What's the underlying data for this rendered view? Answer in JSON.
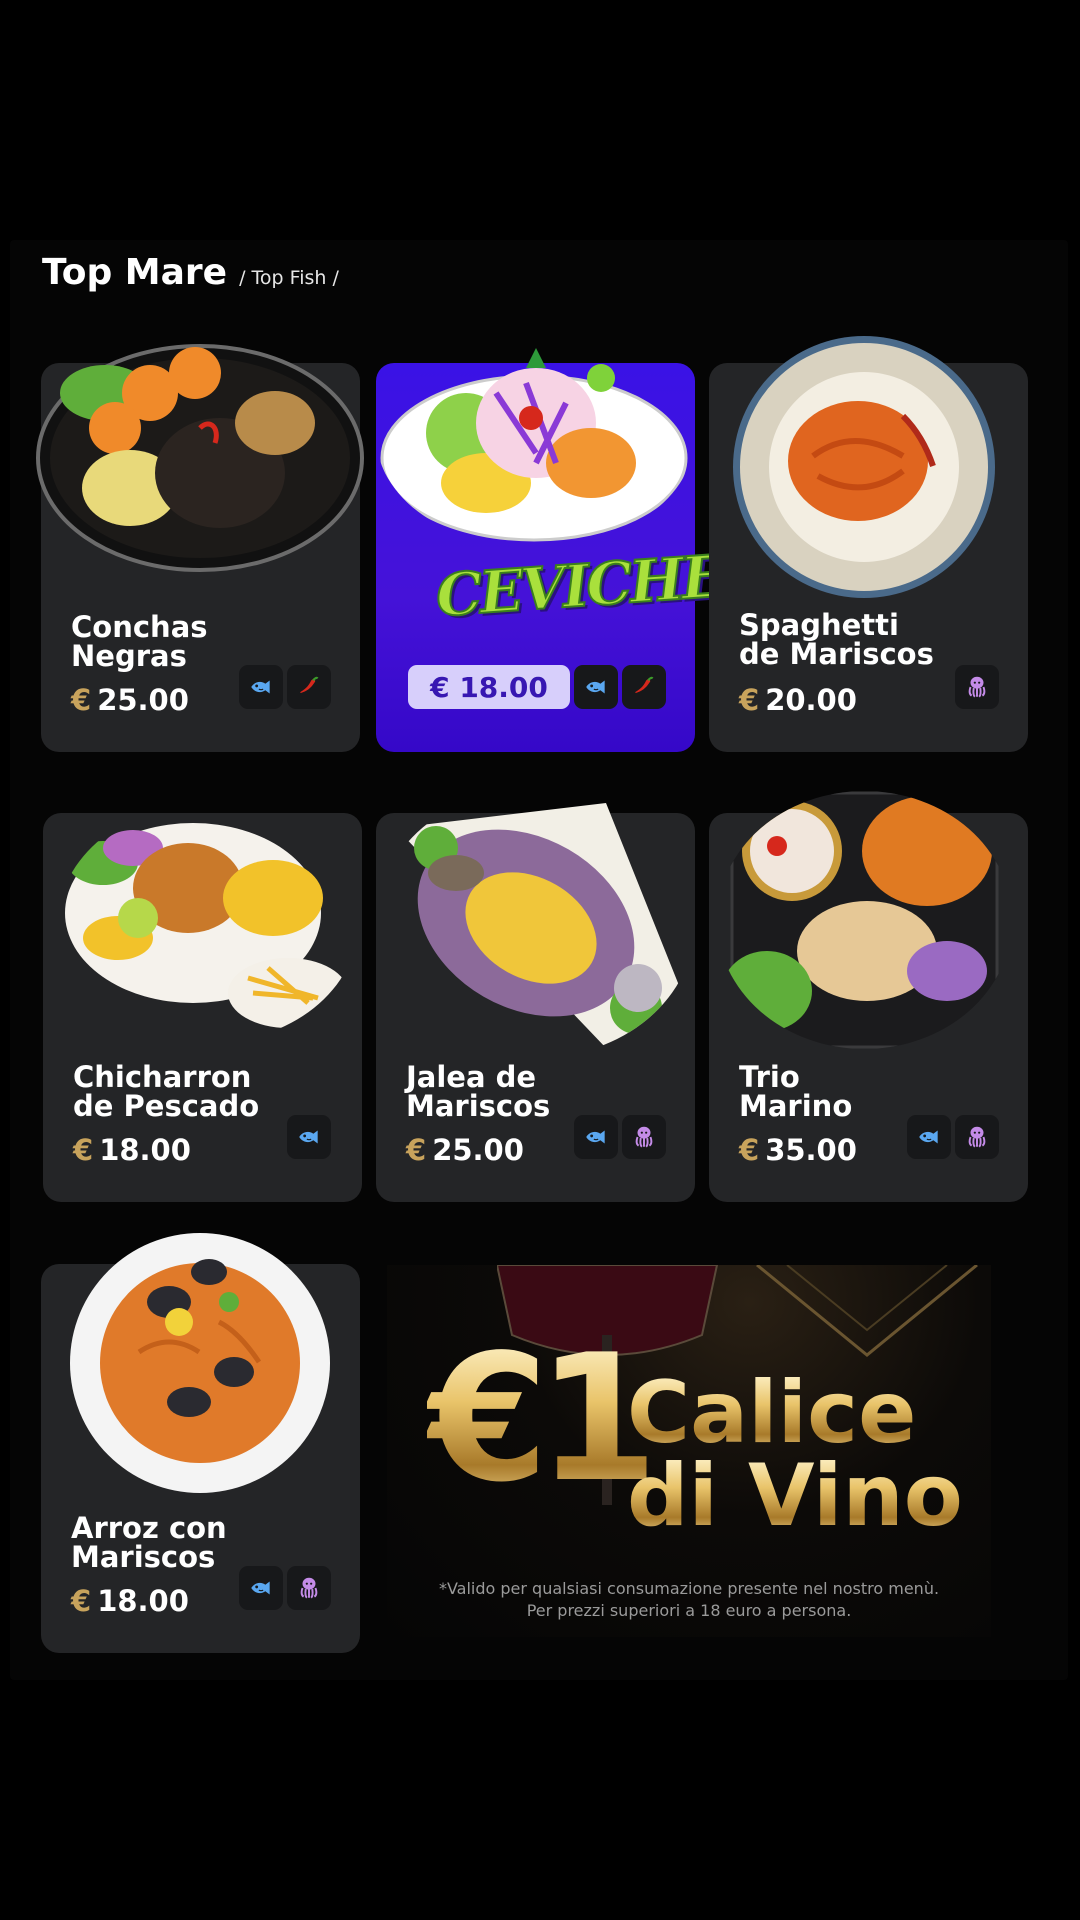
{
  "section": {
    "title": "Top Mare",
    "subtitle": "/ Top Fish /"
  },
  "currency_symbol": "€",
  "items": [
    {
      "name_line1": "Conchas",
      "name_line2": "Negras",
      "price": "25.00",
      "badges": [
        "fish-icon",
        "chili-icon"
      ]
    },
    {
      "logo_text": "CEVICHE",
      "price_label": "€ 18.00",
      "badges": [
        "fish-icon",
        "chili-icon"
      ]
    },
    {
      "name_line1": "Spaghetti",
      "name_line2": "de Mariscos",
      "price": "20.00",
      "badges": [
        "octopus-icon"
      ]
    },
    {
      "name_line1": "Chicharron",
      "name_line2": "de Pescado",
      "price": "18.00",
      "badges": [
        "fish-icon"
      ]
    },
    {
      "name_line1": "Jalea de",
      "name_line2": "Mariscos",
      "price": "25.00",
      "badges": [
        "fish-icon",
        "octopus-icon"
      ]
    },
    {
      "name_line1": "Trio",
      "name_line2": "Marino",
      "price": "35.00",
      "badges": [
        "fish-icon",
        "octopus-icon"
      ]
    },
    {
      "name_line1": "Arroz con",
      "name_line2": "Mariscos",
      "price": "18.00",
      "badges": [
        "fish-icon",
        "octopus-icon"
      ]
    }
  ],
  "promo": {
    "amount": "€1",
    "line1": "Calice",
    "line2": "di Vino",
    "note_line1": "*Valido per qualsiasi consumazione presente nel nostro menù.",
    "note_line2": "Per prezzi superiori a 18 euro a persona."
  },
  "colors": {
    "background": "#000000",
    "card": "#242527",
    "featured": "#3a12e6",
    "gold": "#c8a35c",
    "fish_icon": "#5aa7f0",
    "chili_icon": "#d6281c",
    "octopus_icon": "#c48be8"
  }
}
